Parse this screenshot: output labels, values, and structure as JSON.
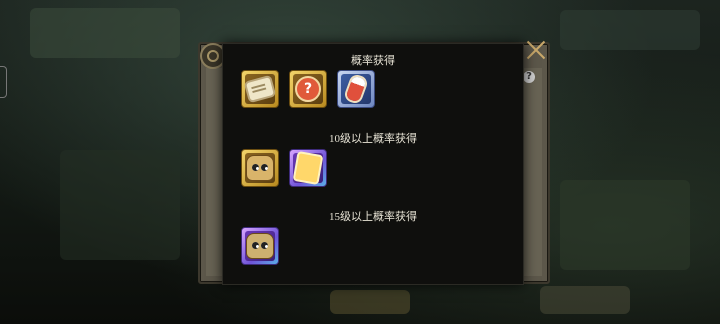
{
  "popup": {
    "sections": [
      {
        "heading": "概率获得",
        "items": [
          {
            "name": "scroll-icon",
            "rarity": "gold"
          },
          {
            "name": "mystery-box-icon",
            "rarity": "gold"
          },
          {
            "name": "potion-icon",
            "rarity": "blue"
          }
        ]
      },
      {
        "heading": "10级以上概率获得",
        "items": [
          {
            "name": "treasure-bag-icon",
            "rarity": "gold"
          },
          {
            "name": "map-scroll-icon",
            "rarity": "purple"
          }
        ]
      },
      {
        "heading": "15级以上概率获得",
        "items": [
          {
            "name": "treasure-bag-icon",
            "rarity": "purple"
          }
        ]
      }
    ]
  },
  "controls": {
    "close_icon": "close-icon",
    "help_label": "?"
  },
  "colors": {
    "gold_frame": "#e8c24a",
    "blue_frame": "#9fb4e6",
    "purple_frame": "#9b6cf0",
    "heading_text": "#e8e4d6",
    "close": "#c9a86a"
  }
}
